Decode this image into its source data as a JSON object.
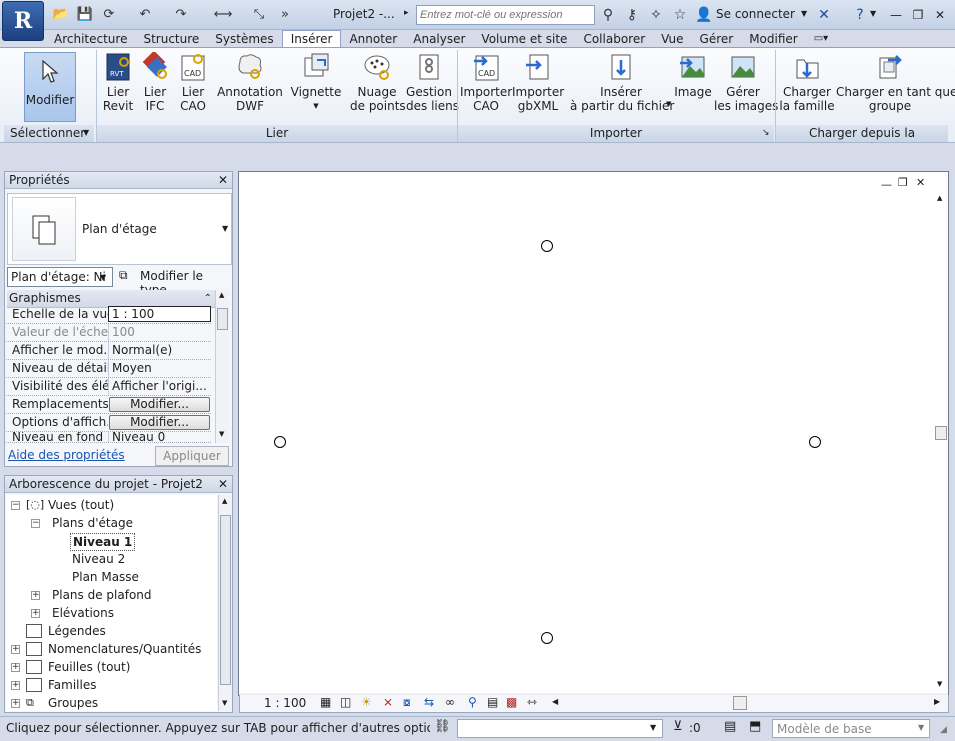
{
  "titlebar": {
    "doc_title": "Projet2 -...",
    "search_placeholder": "Entrez mot-clé ou expression",
    "login": "Se connecter"
  },
  "tabs": [
    "Architecture",
    "Structure",
    "Systèmes",
    "Insérer",
    "Annoter",
    "Analyser",
    "Volume et site",
    "Collaborer",
    "Vue",
    "Gérer",
    "Modifier"
  ],
  "ribbon": {
    "modify": "Modifier",
    "panels": {
      "select": "Sélectionner",
      "link": "Lier",
      "import": "Importer",
      "library": "Charger depuis la bibliothèque"
    },
    "buttons": {
      "link_revit": "Lier\nRevit",
      "link_ifc": "Lier\nIFC",
      "link_cad": "Lier\nCAO",
      "dwf": "Annotation\nDWF",
      "decal": "Vignette",
      "point_cloud": "Nuage\nde points",
      "manage_links": "Gestion\ndes liens",
      "import_cad": "Importer\nCAO",
      "import_gbxml": "Importer\ngbXML",
      "insert_file": "Insérer\nà partir du fichier",
      "image": "Image",
      "manage_images": "Gérer\nles images",
      "load_family": "Charger\nla famille",
      "load_group": "Charger en tant que\ngroupe"
    }
  },
  "properties": {
    "title": "Propriétés",
    "type_name": "Plan d'étage",
    "instance_select": "Plan d'étage: Ni",
    "edit_type": "Modifier le type",
    "section": "Graphismes",
    "rows": [
      {
        "key": "Echelle de la vue",
        "value": "1 : 100"
      },
      {
        "key": "Valeur de l'éche...",
        "value": "100"
      },
      {
        "key": "Afficher le mod...",
        "value": "Normal(e)"
      },
      {
        "key": "Niveau de détail",
        "value": "Moyen"
      },
      {
        "key": "Visibilité des élé...",
        "value": "Afficher l'origi..."
      },
      {
        "key": "Remplacements...",
        "value": "Modifier..."
      },
      {
        "key": "Options d'affich...",
        "value": "Modifier..."
      },
      {
        "key": "Niveau en fond",
        "value": "Niveau 0"
      }
    ],
    "help_link": "Aide des propriétés",
    "apply": "Appliquer"
  },
  "browser": {
    "title": "Arborescence du projet - Projet2",
    "nodes": {
      "views": "Vues (tout)",
      "floor_plans": "Plans d'étage",
      "level1": "Niveau 1",
      "level2": "Niveau 2",
      "site_plan": "Plan Masse",
      "ceiling_plans": "Plans de plafond",
      "elevations": "Elévations",
      "legends": "Légendes",
      "schedules": "Nomenclatures/Quantités",
      "sheets": "Feuilles (tout)",
      "families": "Familles",
      "groups": "Groupes"
    }
  },
  "view": {
    "scale": "1 : 100"
  },
  "statusbar": {
    "message": "Cliquez pour sélectionner. Appuyez sur TAB pour afficher d'autres options, sur C",
    "filter_count": ":0",
    "model": "Modèle de base"
  }
}
